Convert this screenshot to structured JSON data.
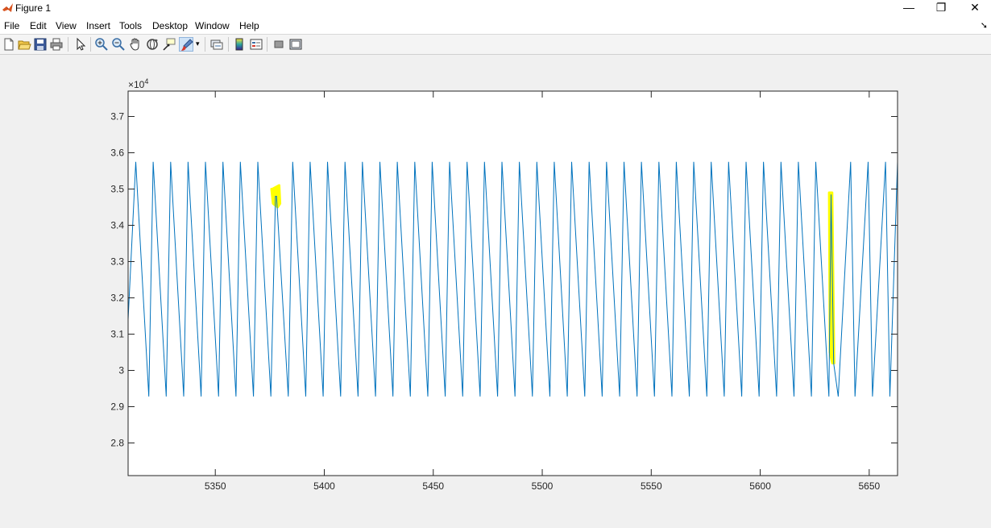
{
  "window": {
    "title": "Figure 1",
    "minimize_glyph": "—",
    "restore_glyph": "❐",
    "close_glyph": "✕"
  },
  "menu": {
    "items": [
      "File",
      "Edit",
      "View",
      "Insert",
      "Tools",
      "Desktop",
      "Window",
      "Help"
    ],
    "overflow_glyph": "➘"
  },
  "toolbar": {
    "buttons": [
      "new-figure-icon",
      "open-file-icon",
      "save-icon",
      "print-icon",
      "edit-plot-arrow-icon",
      "zoom-in-icon",
      "zoom-out-icon",
      "pan-hand-icon",
      "rotate-3d-icon",
      "data-cursor-icon",
      "brush-icon",
      "link-plot-icon",
      "insert-colorbar-icon",
      "insert-legend-icon",
      "hide-plot-tools-icon",
      "show-plot-tools-icon"
    ],
    "active": "brush-icon"
  },
  "chart_data": {
    "type": "line",
    "title": "",
    "xlabel": "",
    "ylabel": "",
    "xlim": [
      5310,
      5663
    ],
    "ylim": [
      27100,
      37700
    ],
    "y_exponent_label": "×10",
    "y_exponent_power": "4",
    "xticks": [
      5350,
      5400,
      5450,
      5500,
      5550,
      5600,
      5650
    ],
    "xtick_labels": [
      "5350",
      "5400",
      "5450",
      "5500",
      "5550",
      "5600",
      "5650"
    ],
    "yticks": [
      28000,
      29000,
      30000,
      31000,
      32000,
      33000,
      34000,
      35000,
      36000,
      37000
    ],
    "ytick_labels": [
      "2.8",
      "2.9",
      "3",
      "3.1",
      "3.2",
      "3.3",
      "3.4",
      "3.5",
      "3.6",
      "3.7"
    ],
    "grid": false,
    "line_color": "#0072bd",
    "series": [
      {
        "x": [
          5310.0,
          5313.5,
          5319.5,
          5321.5,
          5327.5,
          5329.5,
          5335.5,
          5337.5,
          5343.5,
          5345.5,
          5351.5,
          5353.5,
          5359.5,
          5361.5,
          5367.5,
          5369.5,
          5375.5,
          5377.6,
          5378.1,
          5383.5,
          5385.5,
          5391.5,
          5393.5,
          5399.5,
          5401.5,
          5407.5,
          5409.5,
          5415.5,
          5417.5,
          5423.5,
          5425.5,
          5431.5,
          5433.5,
          5439.5,
          5441.5,
          5447.5,
          5449.5,
          5455.5,
          5457.5,
          5463.5,
          5465.5,
          5471.5,
          5473.5,
          5479.5,
          5481.5,
          5487.5,
          5489.5,
          5495.5,
          5497.5,
          5503.5,
          5505.5,
          5511.5,
          5513.5,
          5519.5,
          5521.5,
          5527.5,
          5529.5,
          5535.5,
          5537.5,
          5543.5,
          5545.5,
          5551.5,
          5553.5,
          5559.5,
          5561.5,
          5567.5,
          5569.5,
          5575.5,
          5577.5,
          5583.5,
          5585.5,
          5591.5,
          5593.5,
          5599.5,
          5601.5,
          5607.5,
          5609.5,
          5615.5,
          5617.5,
          5623.5,
          5625.5,
          5631.5,
          5632.5,
          5633.7,
          5635.8,
          5641.5,
          5643.5,
          5649.5,
          5651.5,
          5657.5,
          5659.5,
          5663.0
        ],
        "y": [
          31400,
          35750,
          29280,
          35750,
          29280,
          35750,
          29280,
          35750,
          29280,
          35750,
          29280,
          35750,
          29280,
          35750,
          29280,
          35750,
          29280,
          34800,
          34800,
          29280,
          35750,
          29280,
          35750,
          29280,
          35750,
          29280,
          35750,
          29280,
          35750,
          29280,
          35750,
          29280,
          35750,
          29280,
          35750,
          29280,
          35750,
          29280,
          35750,
          29280,
          35750,
          29280,
          35750,
          29280,
          35750,
          29280,
          35750,
          29280,
          35750,
          29280,
          35750,
          29280,
          35750,
          29280,
          35750,
          29280,
          35750,
          29280,
          35750,
          29280,
          35750,
          29280,
          35750,
          29280,
          35750,
          29280,
          35750,
          29280,
          35750,
          29280,
          35750,
          29280,
          35750,
          29280,
          35750,
          29280,
          35750,
          29280,
          35750,
          29280,
          35750,
          29280,
          34850,
          30200,
          29280,
          35750,
          29280,
          35750,
          29280,
          35750,
          29280,
          35750
        ]
      }
    ],
    "highlights": [
      {
        "color": "#ffff00",
        "x": [
          5376.2,
          5379.3,
          5379.7,
          5378.6,
          5376.5,
          5375.8
        ],
        "y": [
          35000,
          35100,
          34600,
          34500,
          34600,
          35000
        ]
      },
      {
        "color": "#ffff00",
        "x": [
          5631.6,
          5633.0,
          5633.9,
          5633.1,
          5632.0
        ],
        "y": [
          34900,
          34900,
          30200,
          30200,
          30500
        ]
      }
    ]
  }
}
